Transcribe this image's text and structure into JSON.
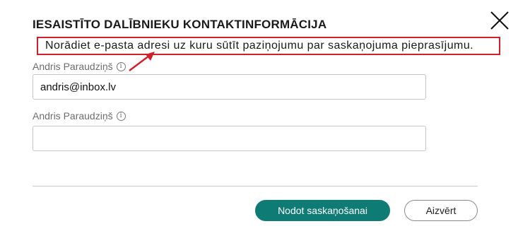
{
  "dialog": {
    "title": "IESAISTĪTO DALĪBNIEKU KONTAKTINFORMĀCIJA",
    "close_icon": "close-icon"
  },
  "callout": {
    "text": "Norādiet e-pasta adresi uz kuru sūtīt paziņojumu par saskaņojuma pieprasījumu.",
    "border_color": "#d0202a"
  },
  "fields": [
    {
      "label": "Andris Paraudziņš",
      "info_icon": "info-icon",
      "value": "andris@inbox.lv",
      "placeholder": ""
    },
    {
      "label": "Andris Paraudziņš",
      "info_icon": "info-icon",
      "value": "",
      "placeholder": ""
    }
  ],
  "buttons": {
    "submit_label": "Nodot saskaņošanai",
    "close_label": "Aizvērt",
    "primary_color": "#0e7b74"
  }
}
